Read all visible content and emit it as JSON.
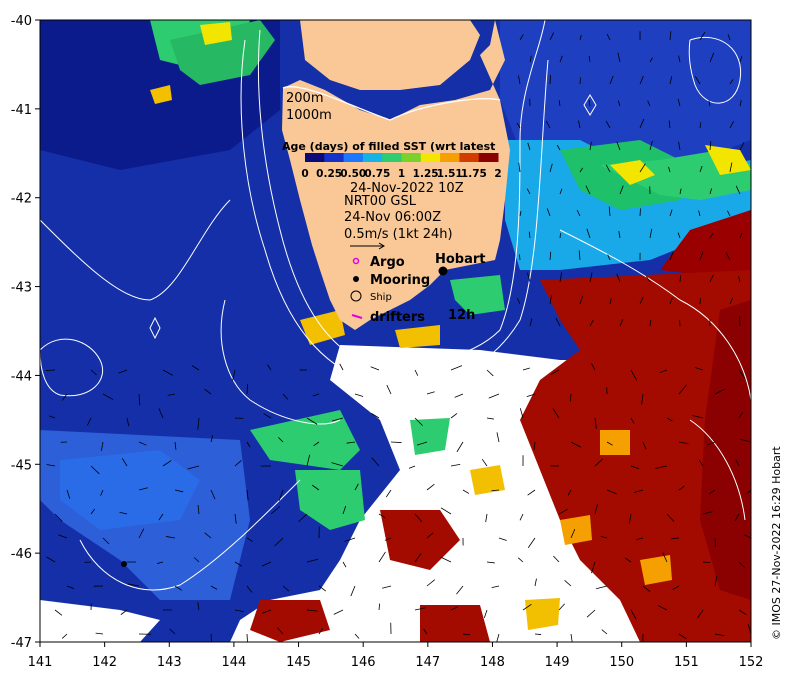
{
  "map": {
    "lon_ticks": [
      "141",
      "142",
      "143",
      "144",
      "145",
      "146",
      "147",
      "148",
      "149",
      "150",
      "151",
      "152"
    ],
    "lat_ticks": [
      "-40",
      "-41",
      "-42",
      "-43",
      "-44",
      "-45",
      "-46",
      "-47"
    ],
    "lon_range": [
      141,
      152
    ],
    "lat_range": [
      -47,
      -40
    ]
  },
  "legend": {
    "depth_200": "200m",
    "depth_1000": "1000m",
    "colorbar_title": "Age (days) of filled SST (wrt latest",
    "colorbar_ticks": [
      "0",
      "0.25",
      "0.50",
      "0.75",
      "1",
      "1.25",
      "1.51",
      "1.75",
      "2"
    ],
    "colorbar_colors": [
      "#0a0a7a",
      "#1432c8",
      "#1e78ff",
      "#14b4e6",
      "#2ecc71",
      "#7ad12b",
      "#f2e600",
      "#f5a000",
      "#d23c00",
      "#8b0000"
    ],
    "date": "24-Nov-2022 10Z",
    "model": "NRT00 GSL",
    "current_time": "24-Nov 06:00Z",
    "current_scale": "0.5m/s (1kt 24h)",
    "argo": "Argo",
    "mooring": "Mooring",
    "ship": "Ship",
    "drifters": "drifters",
    "drifters_suffix": "12h",
    "city": "Hobart"
  },
  "credit": "© IMOS 27-Nov-2022 16:29 Hobart"
}
